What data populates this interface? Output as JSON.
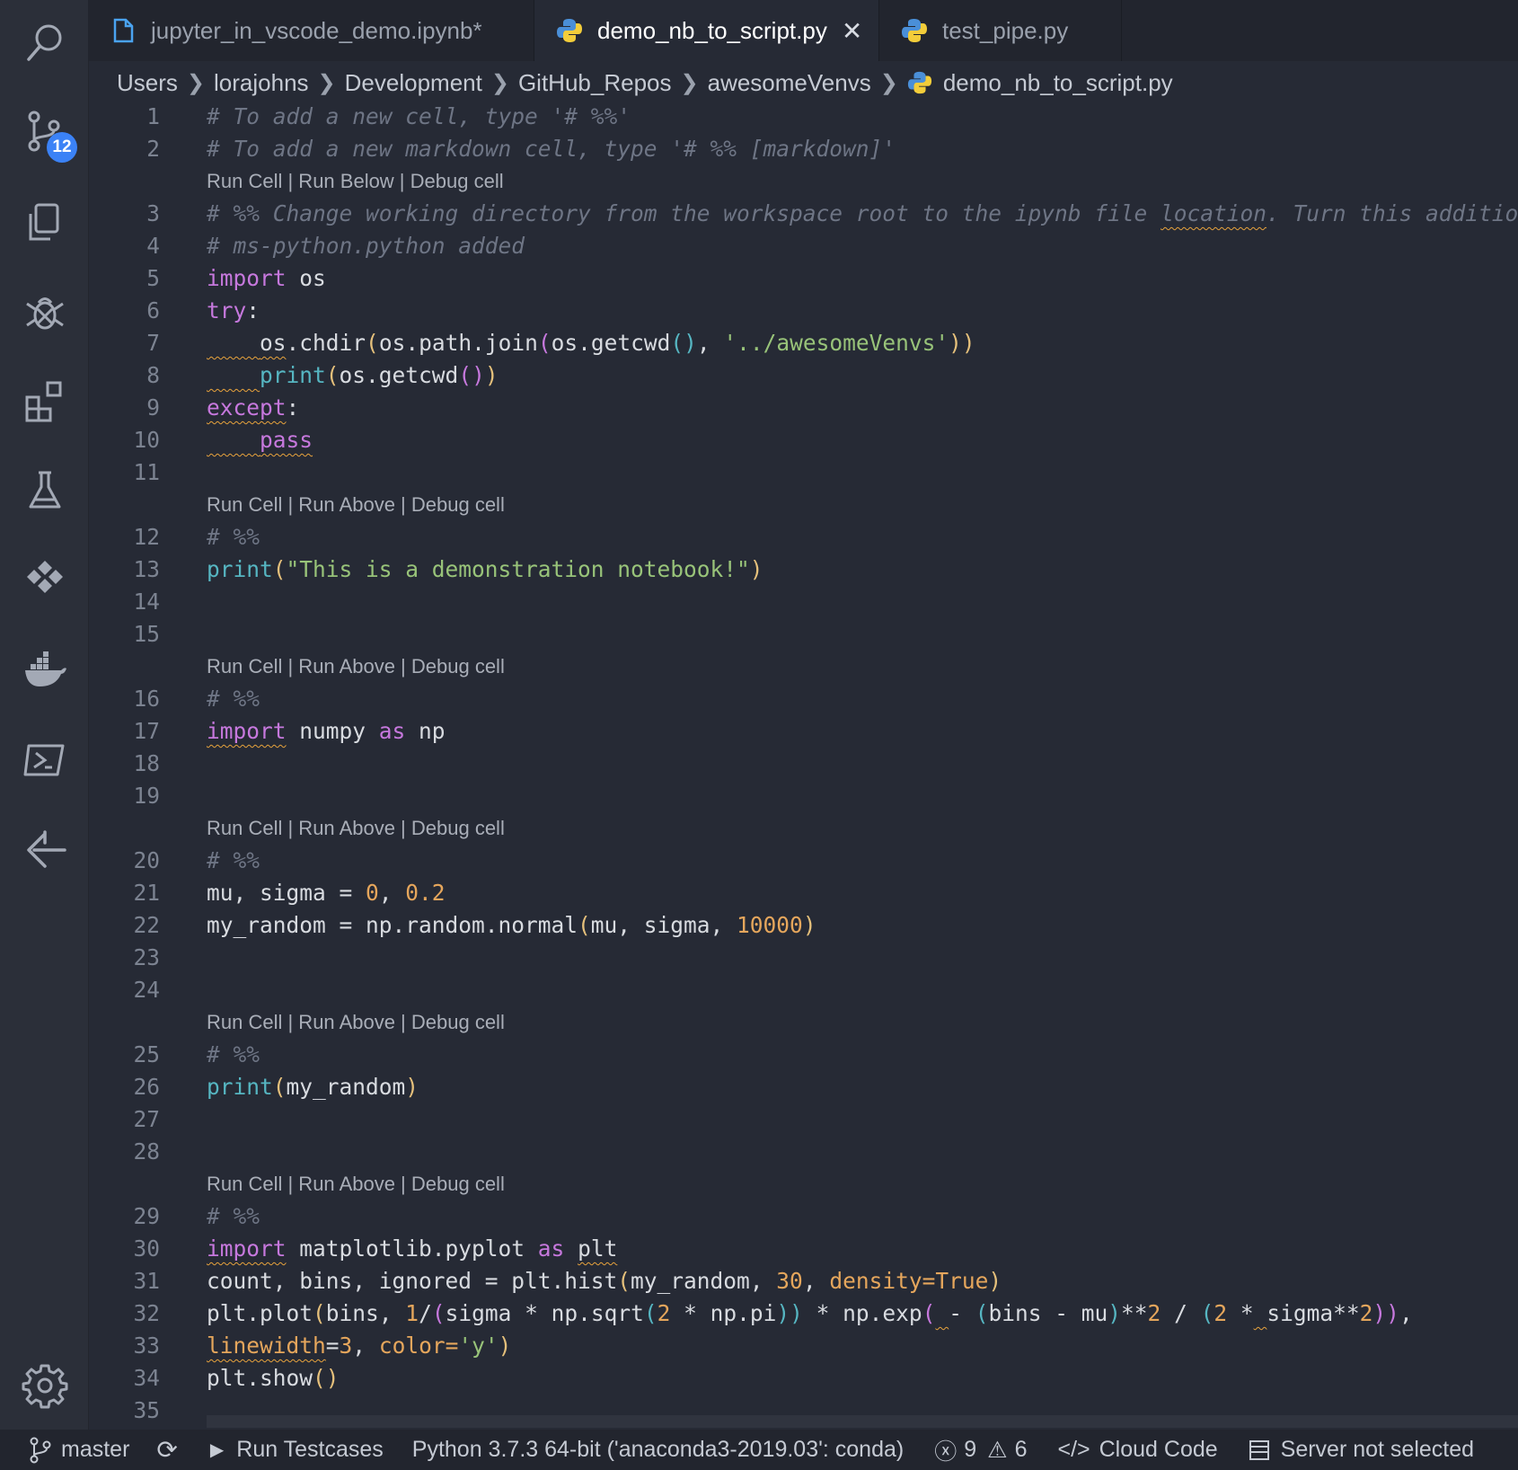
{
  "tabs": [
    {
      "label": "jupyter_in_vscode_demo.ipynb*",
      "icon": "file-icon"
    },
    {
      "label": "demo_nb_to_script.py",
      "icon": "python-icon",
      "active": true
    },
    {
      "label": "test_pipe.py",
      "icon": "python-icon"
    }
  ],
  "breadcrumb": [
    "Users",
    "lorajohns",
    "Development",
    "GitHub_Repos",
    "awesomeVenvs",
    "demo_nb_to_script.py"
  ],
  "activity": {
    "scm_badge": "12"
  },
  "lens": {
    "first": "Run Cell | Run Below | Debug cell",
    "other": "Run Cell | Run Above | Debug cell"
  },
  "lines": {
    "n1": "1",
    "n2": "2",
    "n3": "3",
    "n4": "4",
    "n5": "5",
    "n6": "6",
    "n7": "7",
    "n8": "8",
    "n9": "9",
    "n10": "10",
    "n11": "11",
    "n12": "12",
    "n13": "13",
    "n14": "14",
    "n15": "15",
    "n16": "16",
    "n17": "17",
    "n18": "18",
    "n19": "19",
    "n20": "20",
    "n21": "21",
    "n22": "22",
    "n23": "23",
    "n24": "24",
    "n25": "25",
    "n26": "26",
    "n27": "27",
    "n28": "28",
    "n29": "29",
    "n30": "30",
    "n31": "31",
    "n32": "32",
    "n33": "33",
    "n34": "34",
    "n35": "35"
  },
  "code": {
    "l1": "# To add a new cell, type '# %%'",
    "l2": "# To add a new markdown cell, type '# %% [markdown]'",
    "l3a": "# %% Change working directory from the workspace root to the ipynb file ",
    "l3b": "location",
    "l3c": ". Turn this addition",
    "l4": "# ms-python.python added",
    "l5a": "import",
    "l5b": " os",
    "l6a": "try",
    "l6b": ":",
    "l7a": "    ",
    "l7b": "os",
    "l7c": ".chdir",
    "l7d": "(",
    "l7e": "os.path.join",
    "l7f": "(",
    "l7g": "os.getcwd",
    "l7h": "()",
    "l7i": ", ",
    "l7j": "'../awesomeVenvs'",
    "l7k": "))",
    "l8a": "    ",
    "l8b": "print",
    "l8c": "(",
    "l8d": "os.getcwd",
    "l8e": "()",
    "l8f": ")",
    "l9a": "except",
    "l9b": ":",
    "l10a": "    ",
    "l10b": "pass",
    "l12": "# %%",
    "l13a": "print",
    "l13b": "(",
    "l13c": "\"This is a demonstration notebook!\"",
    "l13d": ")",
    "l16": "# %%",
    "l17a": "import",
    "l17b": " numpy ",
    "l17c": "as",
    "l17d": " np",
    "l20": "# %%",
    "l21a": "mu, sigma = ",
    "l21b": "0",
    "l21c": ", ",
    "l21d": "0.2",
    "l22a": "my_random = np.random.normal",
    "l22b": "(",
    "l22c": "mu, sigma, ",
    "l22d": "10000",
    "l22e": ")",
    "l25": "# %%",
    "l26a": "print",
    "l26b": "(",
    "l26c": "my_random",
    "l26d": ")",
    "l29": "# %%",
    "l30a": "import",
    "l30b": " matplotlib.pyplot ",
    "l30c": "as",
    "l30d": " ",
    "l30e": "plt",
    "l31a": "count, bins, ignored = plt.hist",
    "l31b": "(",
    "l31c": "my_random, ",
    "l31d": "30",
    "l31e": ", ",
    "l31f": "density=True",
    "l31g": ")",
    "l32a": "plt.plot",
    "l32b": "(",
    "l32c": "bins, ",
    "l32d": "1",
    "l32e": "/",
    "l32f": "(",
    "l32g": "sigma * np.sqrt",
    "l32h": "(",
    "l32i": "2",
    "l32j": " * np.pi",
    "l32k": "))",
    "l32l": " * np.exp",
    "l32m": "(",
    "l32n": " ",
    "l32o": "- ",
    "l32p": "(",
    "l32q": "bins - mu",
    "l32r": ")",
    "l32s": "**",
    "l32t": "2",
    "l32u": " / ",
    "l32v": "(",
    "l32w": "2",
    "l32x": " *",
    "l32y": " ",
    "l32z": "sigma**",
    "l32aa": "2",
    "l32ab": "))",
    "l32ac": ",",
    "l33a": "linewidth",
    "l33b": "=",
    "l33c": "3",
    "l33d": ", ",
    "l33e": "color=",
    "l33f": "'y'",
    "l33g": ")",
    "l34a": "plt.show",
    "l34b": "()"
  },
  "status": {
    "branch": "master",
    "run_testcases": "Run Testcases",
    "interpreter": "Python 3.7.3 64-bit ('anaconda3-2019.03': conda)",
    "errors": "9",
    "warnings": "6",
    "cloud_code": "Cloud Code",
    "server": "Server not selected"
  },
  "colors": {
    "background": "#262a35",
    "keyword": "#c678dd",
    "function": "#56b6c2",
    "string": "#98c379",
    "number": "#e5a65c",
    "badge": "#3b82f6"
  }
}
